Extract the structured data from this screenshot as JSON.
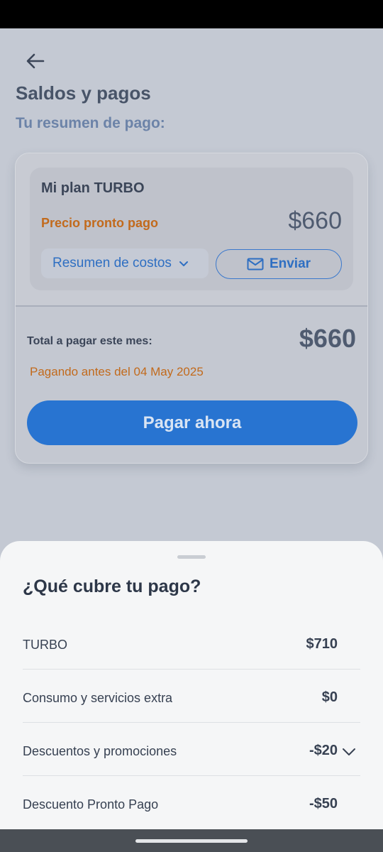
{
  "header": {
    "title": "Saldos y pagos",
    "subtitle": "Tu resumen de pago:"
  },
  "plan": {
    "name": "Mi plan TURBO",
    "price_label": "Precio pronto pago",
    "price": "$660",
    "costs_button": "Resumen de costos",
    "send_button": "Enviar"
  },
  "total": {
    "label": "Total a pagar este mes:",
    "amount": "$660",
    "due_text": "Pagando antes del 04 May 2025",
    "pay_button": "Pagar ahora"
  },
  "sheet": {
    "title": "¿Qué cubre tu pago?",
    "items": [
      {
        "label": "TURBO",
        "value": "$710"
      },
      {
        "label": "Consumo y servicios extra",
        "value": "$0"
      },
      {
        "label": "Descuentos y promociones",
        "value": "-$20"
      },
      {
        "label": "Descuento Pronto Pago",
        "value": "-$50"
      }
    ]
  },
  "colors": {
    "accent": "#2874d1",
    "warning": "#c26a1c"
  },
  "icons": [
    "back-arrow-icon",
    "chevron-down-icon",
    "mail-icon"
  ]
}
